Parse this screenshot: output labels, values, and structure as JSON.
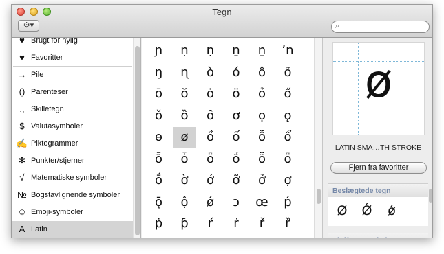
{
  "window": {
    "title": "Tegn"
  },
  "toolbar": {
    "gear_label": "⚙▾",
    "search_placeholder": ""
  },
  "sidebar": {
    "items": [
      {
        "icon": "♥",
        "icon_name": "heart-icon",
        "label": "Brugt for nylig"
      },
      {
        "icon": "♥",
        "icon_name": "heart-icon",
        "label": "Favoritter"
      },
      {
        "icon": "→",
        "icon_name": "arrow-icon",
        "label": "Pile"
      },
      {
        "icon": "()",
        "icon_name": "parentheses-icon",
        "label": "Parenteser"
      },
      {
        "icon": ".,",
        "icon_name": "punctuation-icon",
        "label": "Skilletegn"
      },
      {
        "icon": "$",
        "icon_name": "dollar-icon",
        "label": "Valutasymboler"
      },
      {
        "icon": "✍",
        "icon_name": "pictograph-icon",
        "label": "Piktogrammer"
      },
      {
        "icon": "✻",
        "icon_name": "asterisk-icon",
        "label": "Punkter/stjerner"
      },
      {
        "icon": "√",
        "icon_name": "square-root-icon",
        "label": "Matematiske symboler"
      },
      {
        "icon": "№",
        "icon_name": "numero-icon",
        "label": "Bogstavlignende symboler"
      },
      {
        "icon": "☺",
        "icon_name": "smiley-icon",
        "label": "Emoji-symboler"
      },
      {
        "icon": "A",
        "icon_name": "latin-a-icon",
        "label": "Latin"
      }
    ],
    "selected_index": 11
  },
  "grid": {
    "rows": [
      [
        "ɲ",
        "ṇ",
        "ṇ",
        "ṉ",
        "ṉ",
        "ʼn"
      ],
      [
        "ŋ",
        "ɳ",
        "ò",
        "ó",
        "ô",
        "õ"
      ],
      [
        "ō",
        "ŏ",
        "ȯ",
        "ö",
        "ỏ",
        "ő"
      ],
      [
        "ǒ",
        "ȍ",
        "ȏ",
        "ơ",
        "ọ",
        "ǫ"
      ],
      [
        "ɵ",
        "ø",
        "ồ",
        "ố",
        "ỗ",
        "ổ"
      ],
      [
        "ȭ",
        "ȱ",
        "ȫ",
        "ṍ",
        "ṏ",
        "ȫ"
      ],
      [
        "ṓ",
        "ờ",
        "ớ",
        "ỡ",
        "ở",
        "ợ"
      ],
      [
        "ǭ",
        "ộ",
        "ǿ",
        "ɔ",
        "œ",
        "ṕ"
      ],
      [
        "ṗ",
        "ƥ",
        "ŕ",
        "ṙ",
        "ř",
        "ȑ"
      ]
    ],
    "selected": [
      4,
      1
    ]
  },
  "inspector": {
    "glyph": "ø",
    "char_name": "LATIN SMA…TH STROKE",
    "favorite_button": "Fjern fra favoritter",
    "related_header": "Beslægtede tegn",
    "related_chars": [
      "Ø",
      "Ǿ",
      "ǿ"
    ],
    "variation_header": "Skrifttypevariation"
  }
}
